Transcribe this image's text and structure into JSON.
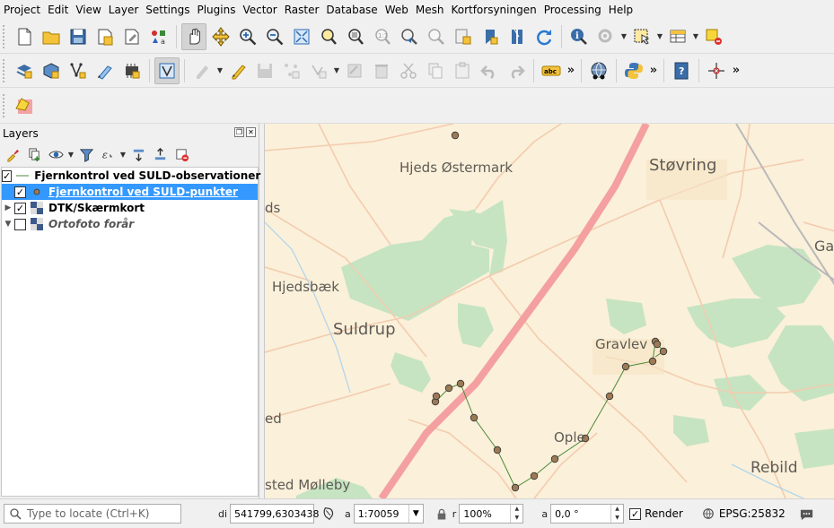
{
  "menubar": {
    "items": [
      "Project",
      "Edit",
      "View",
      "Layer",
      "Settings",
      "Plugins",
      "Vector",
      "Raster",
      "Database",
      "Web",
      "Mesh",
      "Kortforsyningen",
      "Processing",
      "Help"
    ]
  },
  "icons": {
    "toolbar1": [
      "new-project-icon",
      "open-project-icon",
      "save-project-icon",
      "save-as-icon",
      "print-layout-icon",
      "style-manager-icon",
      "pan-icon",
      "pan-to-selection-icon",
      "zoom-in-icon",
      "zoom-out-icon",
      "zoom-full-icon",
      "zoom-to-selection-icon",
      "zoom-to-layer-icon",
      "zoom-native-icon",
      "zoom-last-icon",
      "zoom-next-icon",
      "new-bookmark-icon",
      "show-bookmarks-icon",
      "temporal-controller-icon",
      "refresh-icon",
      "identify-icon",
      "action-icon",
      "select-features-icon",
      "attribute-table-icon",
      "deselect-icon"
    ],
    "toolbar2": [
      "data-source-manager-icon",
      "new-geopackage-icon",
      "new-shapefile-icon",
      "digitize-icon",
      "gps-icon",
      "virtual-layer-icon",
      "current-edits-icon",
      "toggle-editing-icon",
      "save-edits-icon",
      "vertex-tool-icon",
      "add-feature-icon",
      "delete-icon",
      "cut-icon",
      "copy-icon",
      "paste-icon",
      "undo-icon",
      "redo-icon",
      "label-icon",
      "globe-icon",
      "python-icon",
      "help-icon",
      "crosshair-icon"
    ],
    "toolbar3": [
      "kortforsyningen-plugin-icon"
    ]
  },
  "layers_panel": {
    "title": "Layers",
    "layers": [
      {
        "name": "Fjernkontrol ved SULD-observationer",
        "checked": true,
        "selected": false,
        "style": "bold",
        "icon": "line-symbol-icon"
      },
      {
        "name": "Fjernkontrol ved SULD-punkter",
        "checked": true,
        "selected": true,
        "style": "bold",
        "icon": "point-symbol-icon"
      },
      {
        "name": "DTK/Skærmkort",
        "checked": true,
        "selected": false,
        "style": "bold",
        "icon": "raster-layer-icon"
      },
      {
        "name": "Ortofoto forår",
        "checked": false,
        "selected": false,
        "style": "italic",
        "icon": "raster-layer-icon"
      }
    ]
  },
  "map": {
    "labels": [
      "Hjeds Østermark",
      "Støvring",
      "ds",
      "Hjedsbæk",
      "Suldrup",
      "Gravlev",
      "ed",
      "Ople",
      "Rebild",
      "sted Mølleby",
      "Ga"
    ]
  },
  "statusbar": {
    "locate_placeholder": "Type to locate (Ctrl+K)",
    "coord_label": "di",
    "coordinate": "541799,6303438",
    "scale_label": "a",
    "scale": "1:70059",
    "magnifier_label": "r",
    "magnifier": "100%",
    "rotation_label": "a",
    "rotation": "0,0 °",
    "render_label": "Render",
    "render_checked": true,
    "crs": "EPSG:25832"
  },
  "colors": {
    "map_background": "#fbf0d9",
    "forest": "#c6e4c2",
    "highway": "#f4a0a0",
    "point_fill": "#9c7a55",
    "line": "#4c8a3c",
    "selection": "#3399ff"
  }
}
